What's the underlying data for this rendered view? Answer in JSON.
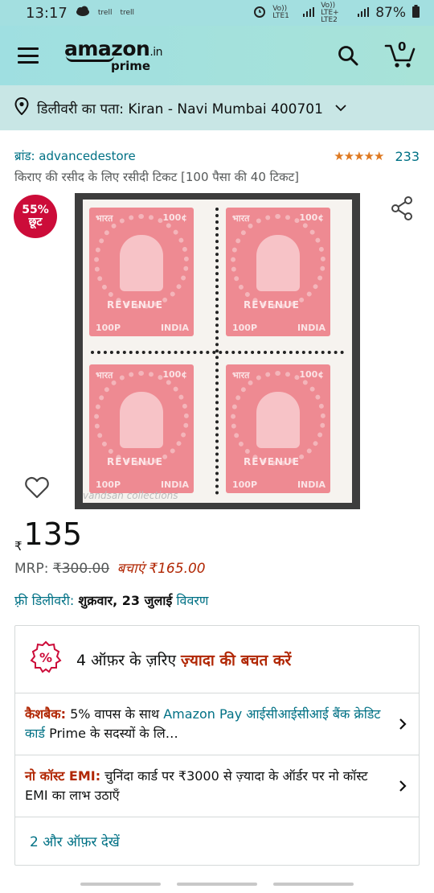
{
  "status_bar": {
    "time": "13:17",
    "carrier_a": "trell",
    "carrier_b": "trell",
    "sim1": "Vo)) LTE1",
    "sim2": "Vo)) LTE+ LTE2",
    "battery": "87%"
  },
  "header": {
    "logo_word": "amazon",
    "logo_suffix": ".in",
    "logo_prime": "prime",
    "cart_count": "0"
  },
  "delivery": {
    "label": "डिलीवरी का पता: Kiran - Navi Mumbai 400701"
  },
  "product": {
    "brand": "ब्रांड: advancedestore",
    "stars": "★★★★★",
    "rating_value": 4.5,
    "rating_count": "233",
    "title": "किराए की रसीद के लिए रसीदी टिकट [100 पैसा की 40 टिकट]",
    "discount_pct": "55%",
    "discount_word": "छूट",
    "stamp_text_top_left": "भारत",
    "stamp_text_top_right": "100¢",
    "stamp_revenue": "REVENUE",
    "stamp_bottom_left": "100P",
    "stamp_bottom_right": "INDIA",
    "watermark": "vandsan collections"
  },
  "price": {
    "currency": "₹",
    "amount": "135",
    "mrp_label": "MRP:",
    "mrp_value": "₹300.00",
    "savings": "बचाएं ₹165.00"
  },
  "free_delivery": {
    "label": "फ़्री डिलीवरी:",
    "date": "शुक्रवार, 23 जुलाई",
    "details": "विवरण"
  },
  "offers": {
    "header_prefix": "4 ऑफ़र के ज़रिए",
    "header_highlight": "ज़्यादा की बचत करें",
    "items": [
      {
        "tag": "कैशबैक:",
        "text_a": " 5% वापस के साथ ",
        "link_a": "Amazon Pay आईसीआईसीआई बैंक क्रेडिट कार्ड",
        "text_b": " Prime के सदस्यों के लि…"
      },
      {
        "tag": "नो कॉस्ट EMI:",
        "text_a": " चुनिंदा कार्ड पर ₹3000 से ज़्यादा के ऑर्डर पर नो कॉस्ट EMI का लाभ उठाएँ",
        "link_a": "",
        "text_b": ""
      }
    ],
    "more_label": "2 और ऑफ़र देखें"
  },
  "colors": {
    "header_bg": "#a3dfe0",
    "delivery_bg": "#c8e6e5",
    "link": "#007185",
    "deal_red": "#b12704",
    "badge_red": "#cc0c39",
    "star_orange": "#de7921"
  }
}
